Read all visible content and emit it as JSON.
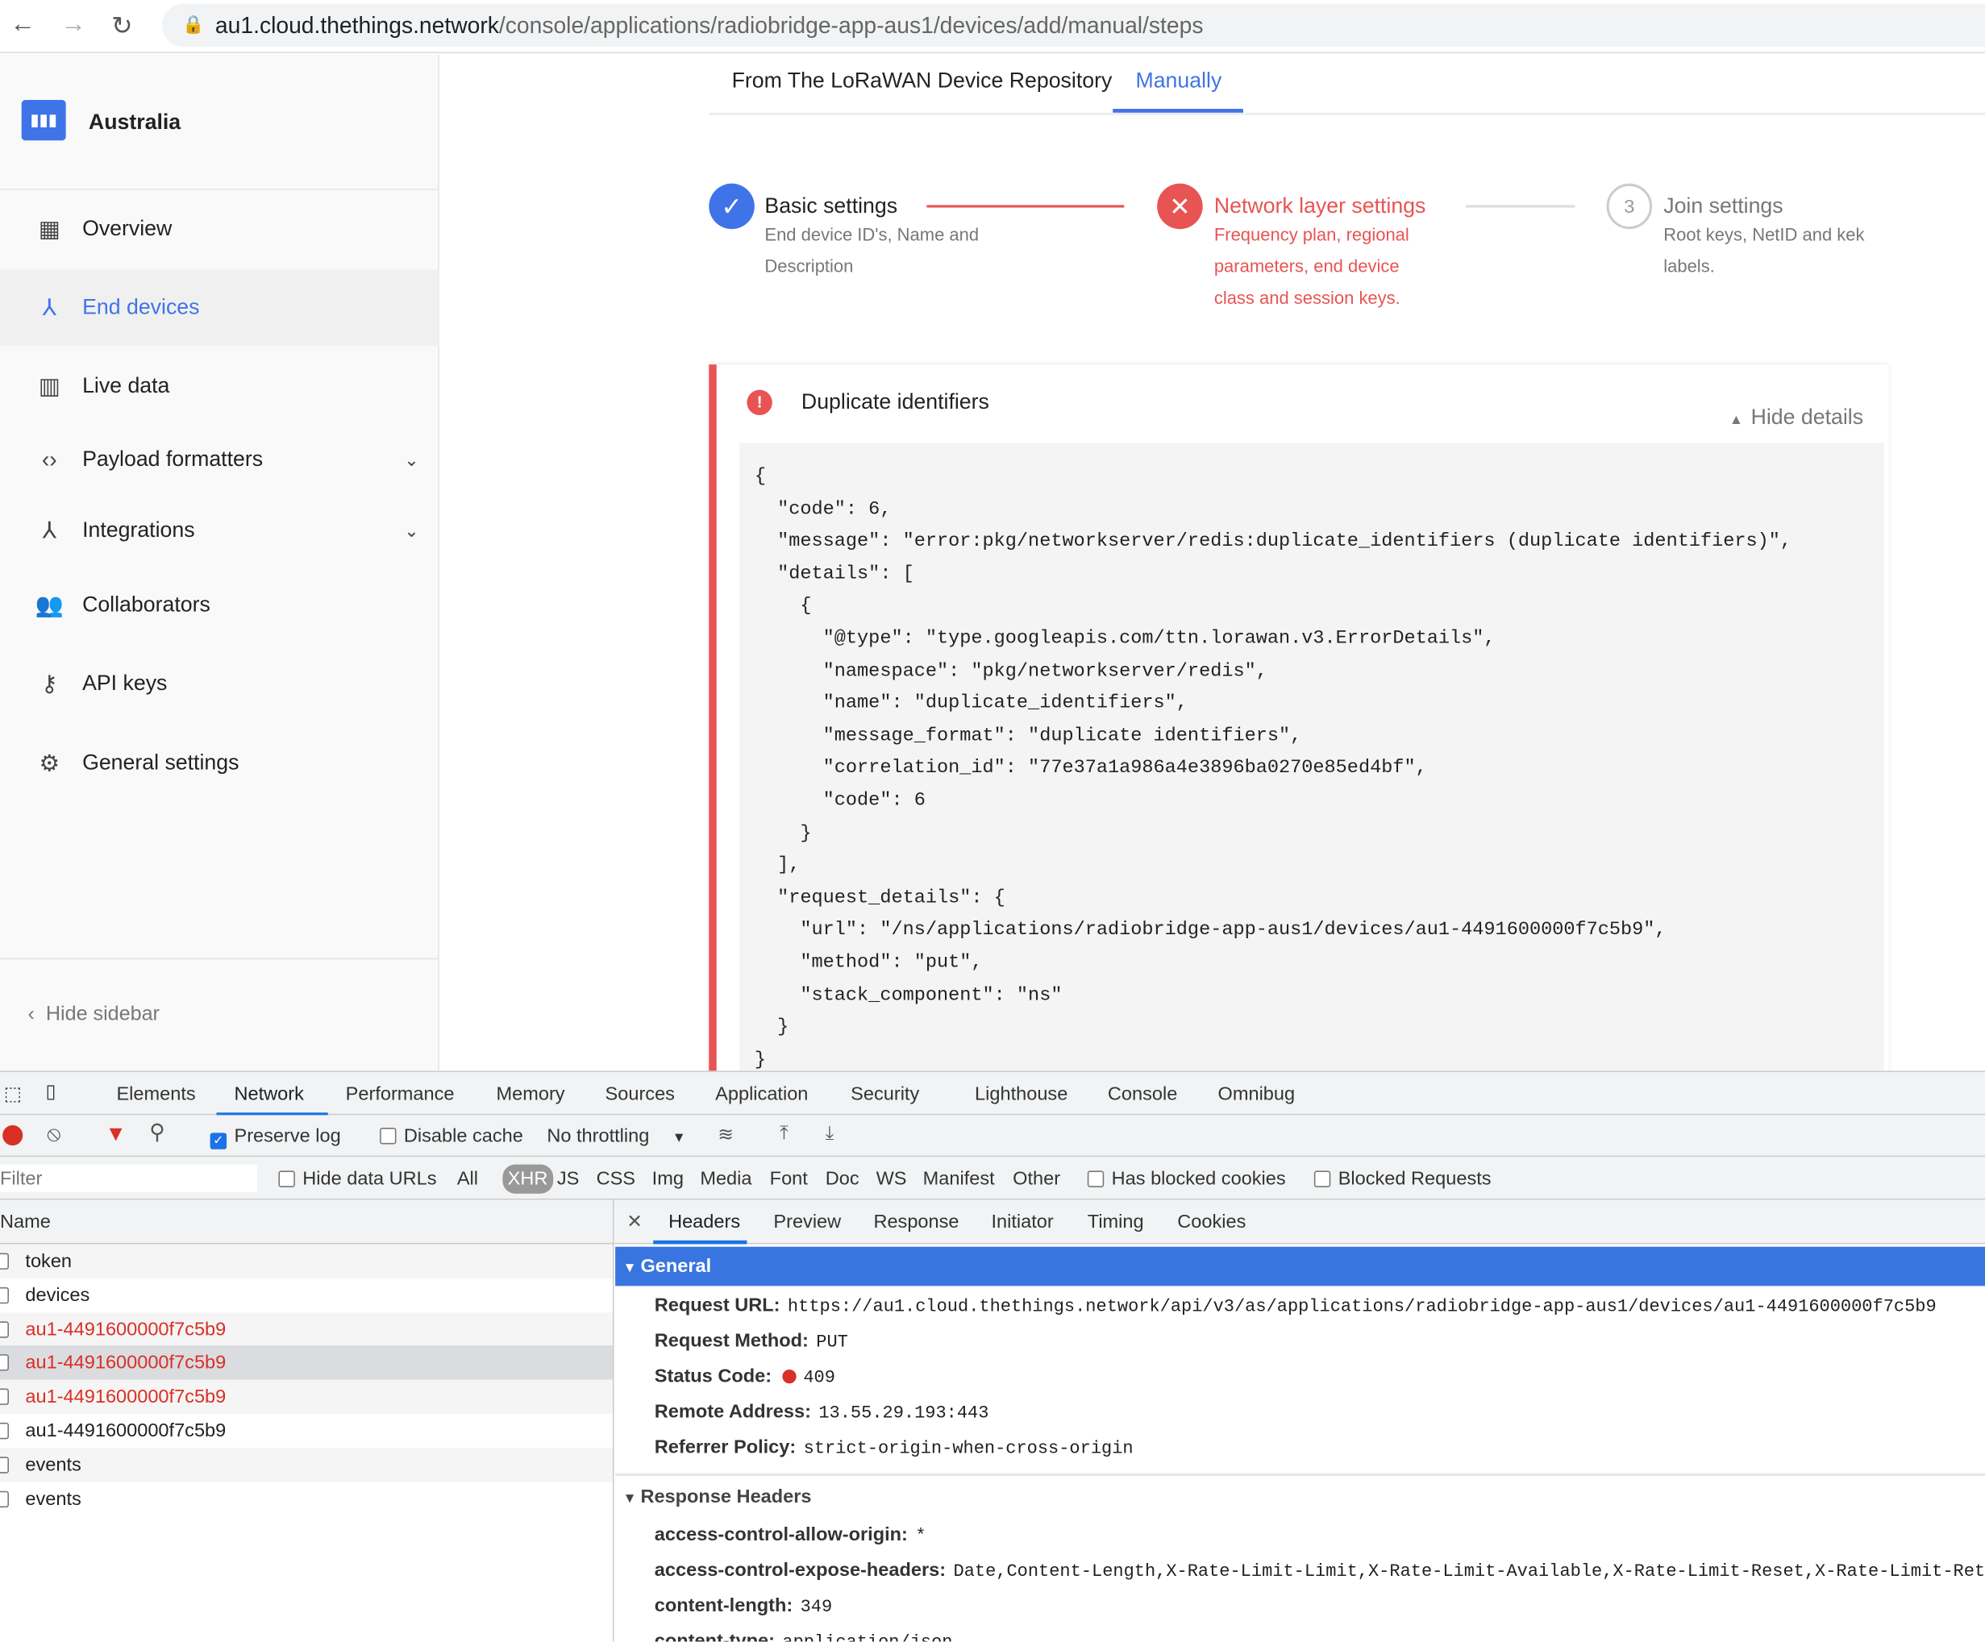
{
  "browser": {
    "url_host": "au1.cloud.thethings.network",
    "url_path": "/console/applications/radiobridge-app-aus1/devices/add/manual/steps"
  },
  "sidebar": {
    "title": "Australia",
    "items": [
      {
        "label": "Overview",
        "icon": "dashboard-icon"
      },
      {
        "label": "End devices",
        "icon": "devices-icon",
        "active": true
      },
      {
        "label": "Live data",
        "icon": "chart-icon"
      },
      {
        "label": "Payload formatters",
        "icon": "code-icon",
        "expandable": true
      },
      {
        "label": "Integrations",
        "icon": "merge-icon",
        "expandable": true
      },
      {
        "label": "Collaborators",
        "icon": "people-icon"
      },
      {
        "label": "API keys",
        "icon": "key-icon"
      },
      {
        "label": "General settings",
        "icon": "gear-icon"
      }
    ],
    "hide_label": "Hide sidebar"
  },
  "tabs": [
    {
      "label": "From The LoRaWAN Device Repository"
    },
    {
      "label": "Manually",
      "active": true
    }
  ],
  "steps": [
    {
      "number": "1",
      "title": "Basic settings",
      "desc": "End device ID's, Name and Description",
      "state": "done"
    },
    {
      "number": "2",
      "title": "Network layer settings",
      "desc": "Frequency plan, regional parameters, end device class and session keys.",
      "state": "error"
    },
    {
      "number": "3",
      "title": "Join settings",
      "desc": "Root keys, NetID and kek labels.",
      "state": "pending"
    }
  ],
  "error": {
    "title": "Duplicate identifiers",
    "toggle": "Hide details",
    "details": "{\n  \"code\": 6,\n  \"message\": \"error:pkg/networkserver/redis:duplicate_identifiers (duplicate identifiers)\",\n  \"details\": [\n    {\n      \"@type\": \"type.googleapis.com/ttn.lorawan.v3.ErrorDetails\",\n      \"namespace\": \"pkg/networkserver/redis\",\n      \"name\": \"duplicate_identifiers\",\n      \"message_format\": \"duplicate identifiers\",\n      \"correlation_id\": \"77e37a1a986a4e3896ba0270e85ed4bf\",\n      \"code\": 6\n    }\n  ],\n  \"request_details\": {\n    \"url\": \"/ns/applications/radiobridge-app-aus1/devices/au1-4491600000f7c5b9\",\n    \"method\": \"put\",\n    \"stack_component\": \"ns\"\n  }\n}"
  },
  "devtools": {
    "tabs": [
      "Elements",
      "Network",
      "Performance",
      "Memory",
      "Sources",
      "Application",
      "Security",
      "Lighthouse",
      "Console",
      "Omnibug"
    ],
    "active_tab": "Network",
    "toolbar": {
      "preserve_log": "Preserve log",
      "disable_cache": "Disable cache",
      "throttling": "No throttling"
    },
    "filter": {
      "placeholder": "Filter",
      "hide_data_urls": "Hide data URLs",
      "types": [
        "All",
        "XHR",
        "JS",
        "CSS",
        "Img",
        "Media",
        "Font",
        "Doc",
        "WS",
        "Manifest",
        "Other"
      ],
      "active_type": "XHR",
      "has_blocked": "Has blocked cookies",
      "blocked_requests": "Blocked Requests"
    },
    "name_header": "Name",
    "requests": [
      {
        "name": "token",
        "error": false
      },
      {
        "name": "devices",
        "error": false
      },
      {
        "name": "au1-4491600000f7c5b9",
        "error": true
      },
      {
        "name": "au1-4491600000f7c5b9",
        "error": true,
        "selected": true
      },
      {
        "name": "au1-4491600000f7c5b9",
        "error": true
      },
      {
        "name": "au1-4491600000f7c5b9",
        "error": false
      },
      {
        "name": "events",
        "error": false
      },
      {
        "name": "events",
        "error": false
      }
    ],
    "detail_tabs": [
      "Headers",
      "Preview",
      "Response",
      "Initiator",
      "Timing",
      "Cookies"
    ],
    "general_title": "General",
    "general": [
      {
        "k": "Request URL:",
        "v": "https://au1.cloud.thethings.network/api/v3/as/applications/radiobridge-app-aus1/devices/au1-4491600000f7c5b9"
      },
      {
        "k": "Request Method:",
        "v": "PUT"
      },
      {
        "k": "Status Code:",
        "v": "409"
      },
      {
        "k": "Remote Address:",
        "v": "13.55.29.193:443"
      },
      {
        "k": "Referrer Policy:",
        "v": "strict-origin-when-cross-origin"
      }
    ],
    "response_title": "Response Headers",
    "response": [
      {
        "k": "access-control-allow-origin:",
        "v": "*"
      },
      {
        "k": "access-control-expose-headers:",
        "v": "Date,Content-Length,X-Rate-Limit-Limit,X-Rate-Limit-Available,X-Rate-Limit-Reset,X-Rate-Limit-Retry-After"
      },
      {
        "k": "content-length:",
        "v": "349"
      },
      {
        "k": "content-type:",
        "v": "application/json"
      }
    ]
  }
}
